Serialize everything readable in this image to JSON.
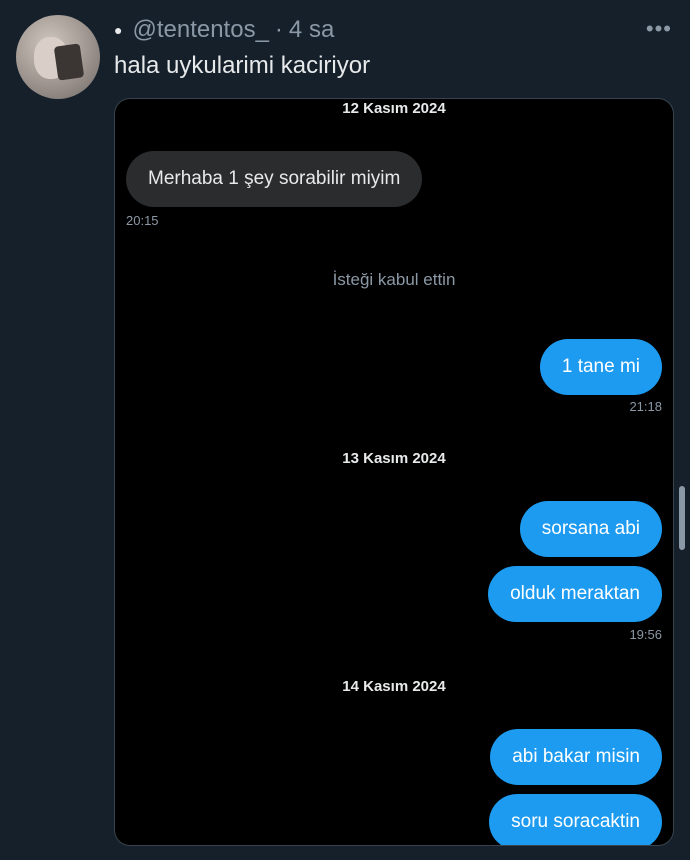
{
  "tweet": {
    "handle": "@tententos_",
    "separator": "·",
    "time_ago": "4 sa",
    "text": "hala uykularimi kaciriyor",
    "more_icon": "more-icon"
  },
  "chat": {
    "date1": "12 Kasım 2024",
    "msg1": "Merhaba 1 şey sorabilir miyim",
    "time1": "20:15",
    "system1": "İsteği kabul ettin",
    "msg2": "1 tane mi",
    "time2": "21:18",
    "date2": "13 Kasım 2024",
    "msg3": "sorsana abi",
    "msg4": "olduk meraktan",
    "time3": "19:56",
    "date3": "14 Kasım 2024",
    "msg5": "abi bakar misin",
    "msg6": "soru soracaktin"
  },
  "colors": {
    "background": "#15202b",
    "outgoing_bubble": "#1d9bf0",
    "incoming_bubble": "#2b2c2e"
  }
}
